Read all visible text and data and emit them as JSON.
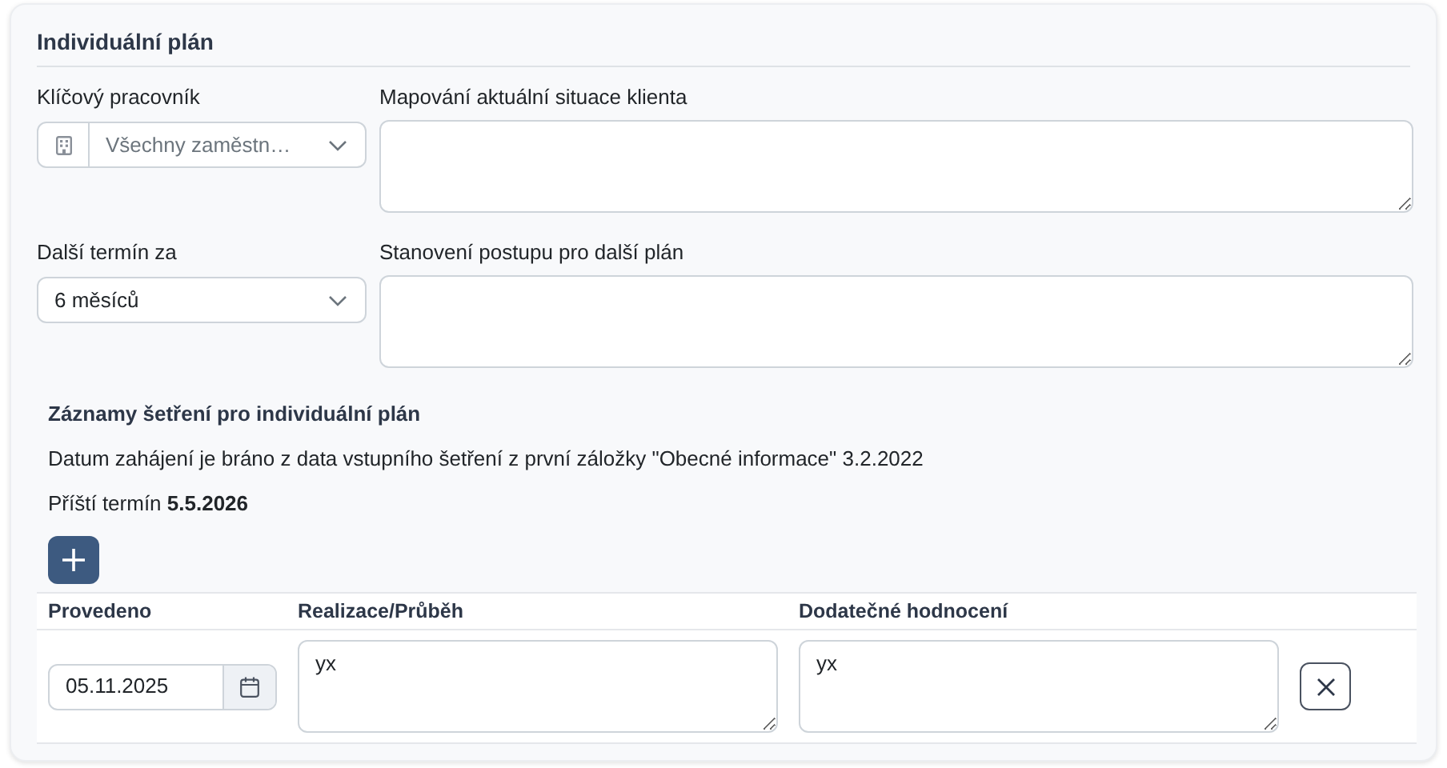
{
  "title": "Individuální plán",
  "worker": {
    "label": "Klíčový pracovník",
    "value": "Všechny zaměstn…"
  },
  "mapping": {
    "label": "Mapování aktuální situace klienta"
  },
  "next_term": {
    "label": "Další termín za",
    "value": "6 měsíců"
  },
  "procedure": {
    "label": "Stanovení postupu pro další plán"
  },
  "records": {
    "title": "Záznamy šetření pro individuální plán",
    "note": "Datum zahájení je bráno z data vstupního šetření z první záložky \"Obecné informace\" 3.2.2022",
    "next": "Příští termín **5.5.2026**",
    "columns": [
      "Provedeno",
      "Realizace/Průběh",
      "Dodatečné hodnocení"
    ],
    "rows": [
      {
        "date": "05.11.2025",
        "realization": "yx",
        "evaluation": "yx"
      }
    ]
  }
}
